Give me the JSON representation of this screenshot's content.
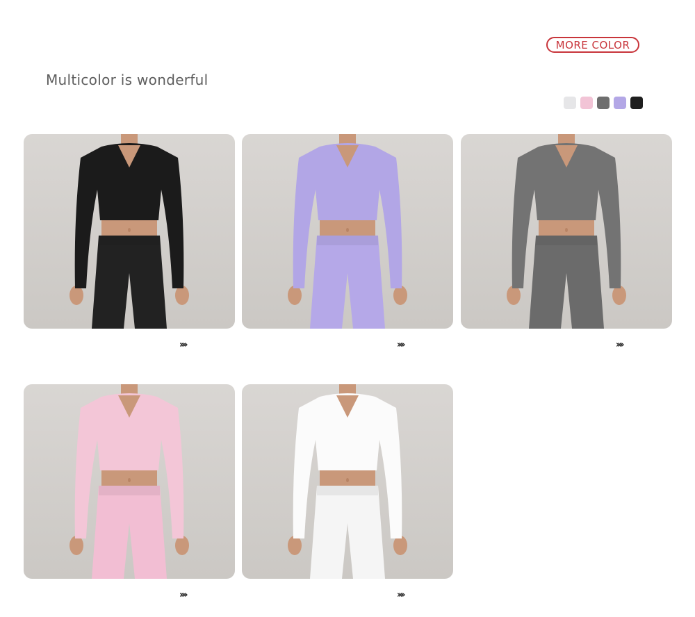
{
  "more_color_label": "MORE COLOR",
  "heading": "Multicolor is wonderful",
  "swatches": [
    {
      "name": "light-grey",
      "color": "#e6e6e8"
    },
    {
      "name": "pink",
      "color": "#f2c4d6"
    },
    {
      "name": "grey",
      "color": "#6e6e6e"
    },
    {
      "name": "lavender",
      "color": "#b3a7e6"
    },
    {
      "name": "black",
      "color": "#1e1e1e"
    }
  ],
  "products": [
    {
      "name": "black",
      "top_color": "#1b1b1b",
      "bottom_color": "#222222",
      "arrows": "››››"
    },
    {
      "name": "lavender",
      "top_color": "#b2a6e6",
      "bottom_color": "#b5a8e8",
      "arrows": "››››"
    },
    {
      "name": "grey",
      "top_color": "#737373",
      "bottom_color": "#6b6b6b",
      "arrows": "››››"
    },
    {
      "name": "pink",
      "top_color": "#f3c6d7",
      "bottom_color": "#f2bed3",
      "arrows": "››››"
    },
    {
      "name": "white",
      "top_color": "#fbfbfb",
      "bottom_color": "#f5f5f5",
      "arrows": "››››"
    }
  ]
}
